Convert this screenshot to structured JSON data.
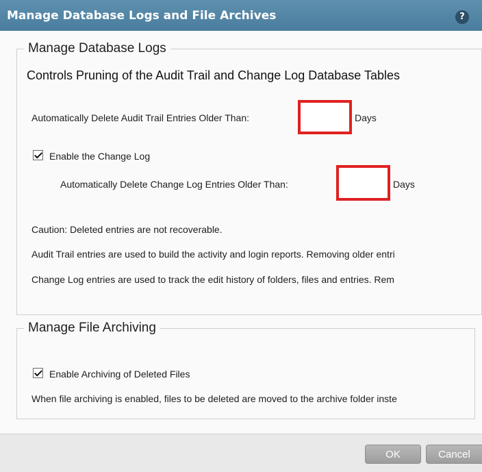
{
  "dialog": {
    "title": "Manage Database Logs and File Archives",
    "help_label": "?"
  },
  "logs_section": {
    "legend": "Manage Database Logs",
    "subtitle": "Controls Pruning of the Audit Trail and Change Log Database Tables",
    "audit_label": "Automatically Delete Audit Trail Entries Older Than:",
    "audit_value": "",
    "audit_unit": "Days",
    "change_log_checkbox_label": "Enable the Change Log",
    "change_log_checked": true,
    "change_label": "Automatically Delete Change Log Entries Older Than:",
    "change_value": "",
    "change_unit": "Days",
    "caution": "Caution: Deleted entries are not recoverable.",
    "audit_note": "Audit Trail entries are used to build the activity and login reports. Removing older entri",
    "change_note": "Change Log entries are used to track the edit history of folders, files and entries. Rem"
  },
  "archive_section": {
    "legend": "Manage File Archiving",
    "checkbox_label": "Enable Archiving of Deleted Files",
    "checked": true,
    "note": "When file archiving is enabled, files to be deleted are moved to the archive folder inste"
  },
  "footer": {
    "ok_label": "OK",
    "cancel_label": "Cancel"
  },
  "colors": {
    "titlebar": "#4a7d9e",
    "highlight_border": "#e02020",
    "button": "#a8a8a8"
  }
}
